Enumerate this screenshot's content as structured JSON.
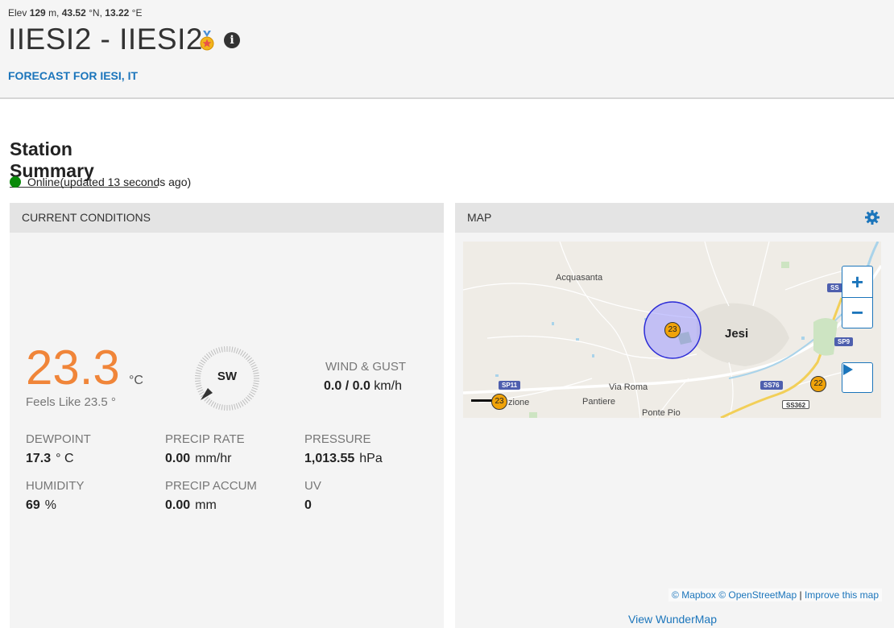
{
  "header": {
    "elev_prefix": "Elev",
    "elev_value": "129",
    "elev_unit": "m,",
    "lat_value": "43.52",
    "lat_unit": "°N,",
    "lon_value": "13.22",
    "lon_unit": "°E",
    "title": "IIESI2 - IIESI2",
    "info_glyph": "i",
    "forecast_link": "FORECAST FOR IESI, IT"
  },
  "summary": {
    "title": "Station Summary",
    "status": "Online(updated 13 seconds ago)",
    "status_color": "#0a8a0a"
  },
  "current": {
    "heading": "CURRENT CONDITIONS",
    "temp": "23.3",
    "temp_unit": "°C",
    "feels_like": "Feels Like 23.5 °",
    "wind_dir": "SW",
    "wind_label": "WIND & GUST",
    "wind_speed": "0.0",
    "wind_gust": "/ 0.0",
    "wind_unit": "km/h",
    "stats": [
      {
        "label": "DEWPOINT",
        "value": "17.3",
        "unit": "° C"
      },
      {
        "label": "PRECIP RATE",
        "value": "0.00",
        "unit": "mm/hr"
      },
      {
        "label": "PRESSURE",
        "value": "1,013.55",
        "unit": "hPa"
      },
      {
        "label": "HUMIDITY",
        "value": "69",
        "unit": "%"
      },
      {
        "label": "PRECIP ACCUM",
        "value": "0.00",
        "unit": "mm"
      },
      {
        "label": "UV",
        "value": "0",
        "unit": ""
      }
    ],
    "accent_color": "#f08539"
  },
  "map_panel": {
    "heading": "MAP",
    "labels": {
      "acquasanta": "Acquasanta",
      "jesi": "Jesi",
      "via_roma": "Via Roma",
      "pantiere": "Pantiere",
      "ponte_pio": "Ponte Pio",
      "zione": "zione"
    },
    "shields": {
      "sp11": "SP11",
      "ss76": "SS76",
      "sp9": "SP9",
      "ss362": "SS362",
      "ss": "SS"
    },
    "markers": [
      "23",
      "22",
      "23"
    ],
    "zoom_in": "+",
    "zoom_out": "−",
    "attribution": {
      "mapbox": "© Mapbox",
      "osm": "© OpenStreetMap",
      "separator": "|",
      "improve": "Improve this map"
    },
    "view_link": "View WunderMap"
  }
}
